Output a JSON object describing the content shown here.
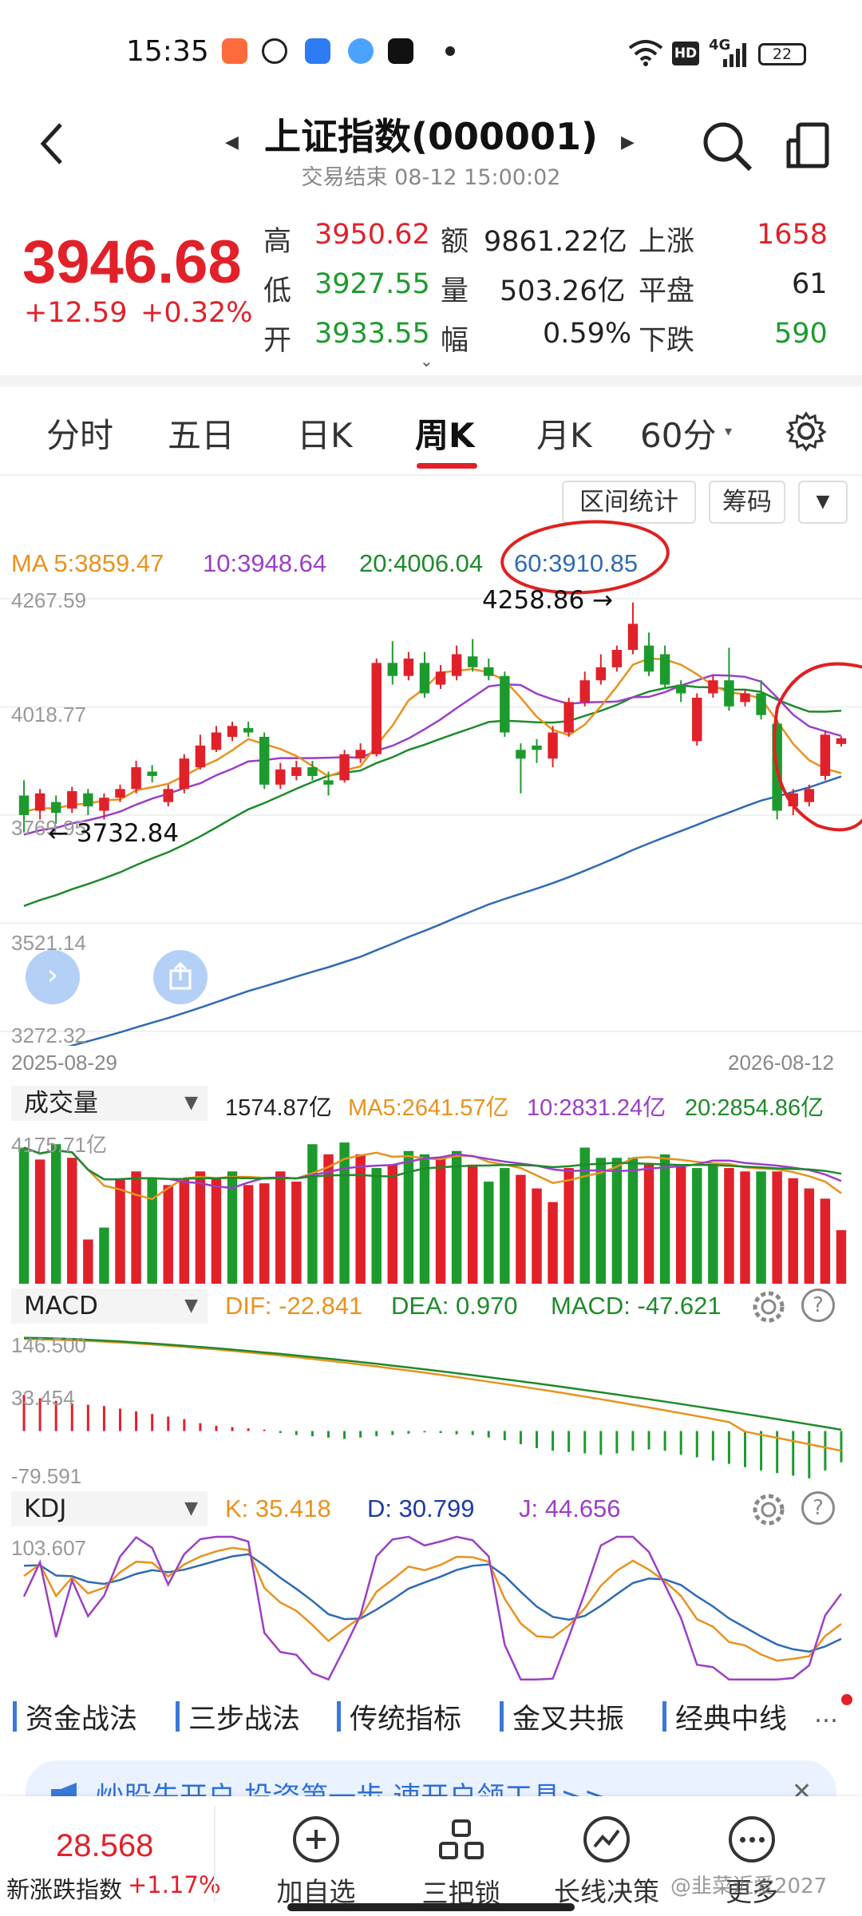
{
  "status": {
    "time": "15:35",
    "net": "4G",
    "battery": "22"
  },
  "header": {
    "title": "上证指数(000001)",
    "subtitle": "交易结束 08-12 15:00:02"
  },
  "quote": {
    "price": "3946.68",
    "change": "+12.59",
    "change_pct": "+0.32%",
    "rows": [
      {
        "l1": "高",
        "v1": "3950.62",
        "l2": "额",
        "v2": "9861.22亿",
        "l3": "上涨",
        "v3": "1658"
      },
      {
        "l1": "低",
        "v1": "3927.55",
        "l2": "量",
        "v2": "503.26亿",
        "l3": "平盘",
        "v3": "61"
      },
      {
        "l1": "开",
        "v1": "3933.55",
        "l2": "幅",
        "v2": "0.59%",
        "l3": "下跌",
        "v3": "590"
      }
    ]
  },
  "tabs": [
    "分时",
    "五日",
    "日K",
    "周K",
    "月K",
    "60分"
  ],
  "active_tab": "周K",
  "chart_tools": {
    "range_stats": "区间统计",
    "chips": "筹码"
  },
  "ma_legend": {
    "ma5": "MA 5:3859.47",
    "ma10": "10:3948.64",
    "ma20": "20:4006.04",
    "ma60": "60:3910.85"
  },
  "kline": {
    "y_ticks": [
      "4267.59",
      "4018.77",
      "3769.95",
      "3521.14",
      "3272.32"
    ],
    "high_label": "4258.86",
    "low_label": "3732.84",
    "date_start": "2025-08-29",
    "date_end": "2026-08-12"
  },
  "volume": {
    "select": "成交量",
    "latest": "1574.87亿",
    "ma5": "MA5:2641.57亿",
    "ma10": "10:2831.24亿",
    "ma20": "20:2854.86亿",
    "max": "4175.71亿"
  },
  "macd": {
    "select": "MACD",
    "dif": "DIF: -22.841",
    "dea": "DEA: 0.970",
    "macd": "MACD: -47.621",
    "top": "146.500",
    "mid": "33.454",
    "bottom": "-79.591"
  },
  "kdj": {
    "select": "KDJ",
    "k": "K: 35.418",
    "d": "D: 30.799",
    "j": "J: 44.656",
    "top": "103.607"
  },
  "strategies": [
    "资金战法",
    "三步战法",
    "传统指标",
    "金叉共振",
    "经典中线"
  ],
  "banner": {
    "text": "炒股先开户 投资第一步 速开户领工具>>"
  },
  "bottom_nav": {
    "index_value": "28.568",
    "index_name": "新涨跌指数",
    "index_change": "+1.17%",
    "items": [
      "加自选",
      "三把锁",
      "长线决策",
      "更多"
    ]
  },
  "watermark": "@韭菜近爱2027",
  "colors": {
    "up": "#e0212a",
    "down": "#1d9a2e",
    "ma5": "#e8921f",
    "ma10": "#9b3fc6",
    "ma20": "#1e8a2a",
    "ma60": "#2f6ab3"
  },
  "chart_data": {
    "type": "candlestick",
    "title": "",
    "ylim": [
      3272.32,
      4267.59
    ],
    "x_range": [
      "2025-08-29",
      "2026-08-12"
    ],
    "candles": [
      {
        "o": 3815,
        "c": 3770,
        "h": 3850,
        "l": 3730
      },
      {
        "o": 3780,
        "c": 3820,
        "h": 3830,
        "l": 3760
      },
      {
        "o": 3800,
        "c": 3775,
        "h": 3815,
        "l": 3750
      },
      {
        "o": 3785,
        "c": 3825,
        "h": 3835,
        "l": 3775
      },
      {
        "o": 3820,
        "c": 3790,
        "h": 3830,
        "l": 3770
      },
      {
        "o": 3780,
        "c": 3810,
        "h": 3820,
        "l": 3760
      },
      {
        "o": 3810,
        "c": 3830,
        "h": 3840,
        "l": 3800
      },
      {
        "o": 3830,
        "c": 3880,
        "h": 3895,
        "l": 3820
      },
      {
        "o": 3870,
        "c": 3860,
        "h": 3885,
        "l": 3845
      },
      {
        "o": 3800,
        "c": 3830,
        "h": 3840,
        "l": 3790
      },
      {
        "o": 3830,
        "c": 3900,
        "h": 3910,
        "l": 3820
      },
      {
        "o": 3880,
        "c": 3930,
        "h": 3955,
        "l": 3875
      },
      {
        "o": 3920,
        "c": 3960,
        "h": 3975,
        "l": 3915
      },
      {
        "o": 3950,
        "c": 3975,
        "h": 3985,
        "l": 3940
      },
      {
        "o": 3970,
        "c": 3960,
        "h": 3985,
        "l": 3950
      },
      {
        "o": 3950,
        "c": 3840,
        "h": 3960,
        "l": 3830
      },
      {
        "o": 3840,
        "c": 3875,
        "h": 3890,
        "l": 3830
      },
      {
        "o": 3860,
        "c": 3880,
        "h": 3895,
        "l": 3850
      },
      {
        "o": 3880,
        "c": 3860,
        "h": 3895,
        "l": 3850
      },
      {
        "o": 3850,
        "c": 3840,
        "h": 3870,
        "l": 3815
      },
      {
        "o": 3850,
        "c": 3910,
        "h": 3920,
        "l": 3845
      },
      {
        "o": 3900,
        "c": 3920,
        "h": 3935,
        "l": 3890
      },
      {
        "o": 3910,
        "c": 4120,
        "h": 4130,
        "l": 3905
      },
      {
        "o": 4120,
        "c": 4090,
        "h": 4170,
        "l": 4070
      },
      {
        "o": 4090,
        "c": 4130,
        "h": 4145,
        "l": 4080
      },
      {
        "o": 4120,
        "c": 4050,
        "h": 4145,
        "l": 4040
      },
      {
        "o": 4070,
        "c": 4100,
        "h": 4115,
        "l": 4060
      },
      {
        "o": 4090,
        "c": 4140,
        "h": 4160,
        "l": 4080
      },
      {
        "o": 4135,
        "c": 4110,
        "h": 4175,
        "l": 4100
      },
      {
        "o": 4110,
        "c": 4090,
        "h": 4130,
        "l": 4080
      },
      {
        "o": 4090,
        "c": 3960,
        "h": 4100,
        "l": 3950
      },
      {
        "o": 3920,
        "c": 3900,
        "h": 3935,
        "l": 3820
      },
      {
        "o": 3930,
        "c": 3920,
        "h": 3945,
        "l": 3890
      },
      {
        "o": 3900,
        "c": 3960,
        "h": 3975,
        "l": 3880
      },
      {
        "o": 3960,
        "c": 4030,
        "h": 4040,
        "l": 3950
      },
      {
        "o": 4030,
        "c": 4080,
        "h": 4100,
        "l": 4020
      },
      {
        "o": 4080,
        "c": 4110,
        "h": 4140,
        "l": 4070
      },
      {
        "o": 4110,
        "c": 4150,
        "h": 4160,
        "l": 4100
      },
      {
        "o": 4150,
        "c": 4210,
        "h": 4258.86,
        "l": 4140
      },
      {
        "o": 4160,
        "c": 4100,
        "h": 4190,
        "l": 4090
      },
      {
        "o": 4140,
        "c": 4070,
        "h": 4160,
        "l": 4060
      },
      {
        "o": 4070,
        "c": 4050,
        "h": 4080,
        "l": 4030
      },
      {
        "o": 3940,
        "c": 4040,
        "h": 4050,
        "l": 3930
      },
      {
        "o": 4050,
        "c": 4080,
        "h": 4090,
        "l": 4040
      },
      {
        "o": 4080,
        "c": 4020,
        "h": 4155,
        "l": 4010
      },
      {
        "o": 4030,
        "c": 4050,
        "h": 4060,
        "l": 4020
      },
      {
        "o": 4050,
        "c": 4000,
        "h": 4080,
        "l": 3990
      },
      {
        "o": 3980,
        "c": 3780,
        "h": 3990,
        "l": 3760
      },
      {
        "o": 3790,
        "c": 3820,
        "h": 3830,
        "l": 3770
      },
      {
        "o": 3800,
        "c": 3830,
        "h": 3840,
        "l": 3790
      },
      {
        "o": 3860,
        "c": 3955,
        "h": 3965,
        "l": 3850
      },
      {
        "o": 3933.55,
        "c": 3946.68,
        "h": 3950.62,
        "l": 3927.55
      }
    ],
    "volume": {
      "ylim": [
        0,
        4175.71
      ],
      "values": [
        {
          "v": 4000,
          "up": false
        },
        {
          "v": 3650,
          "up": true
        },
        {
          "v": 4100,
          "up": false
        },
        {
          "v": 3700,
          "up": true
        },
        {
          "v": 1300,
          "up": true
        },
        {
          "v": 1650,
          "up": false
        },
        {
          "v": 3100,
          "up": true
        },
        {
          "v": 3300,
          "up": true
        },
        {
          "v": 3100,
          "up": false
        },
        {
          "v": 2900,
          "up": true
        },
        {
          "v": 3100,
          "up": true
        },
        {
          "v": 3300,
          "up": true
        },
        {
          "v": 3100,
          "up": true
        },
        {
          "v": 3300,
          "up": false
        },
        {
          "v": 2900,
          "up": true
        },
        {
          "v": 2950,
          "up": true
        },
        {
          "v": 3300,
          "up": true
        },
        {
          "v": 3000,
          "up": true
        },
        {
          "v": 4100,
          "up": false
        },
        {
          "v": 3800,
          "up": true
        },
        {
          "v": 4150,
          "up": false
        },
        {
          "v": 3800,
          "up": true
        },
        {
          "v": 3400,
          "up": false
        },
        {
          "v": 3500,
          "up": true
        },
        {
          "v": 3900,
          "up": false
        },
        {
          "v": 3800,
          "up": false
        },
        {
          "v": 3700,
          "up": true
        },
        {
          "v": 3900,
          "up": false
        },
        {
          "v": 3500,
          "up": true
        },
        {
          "v": 3000,
          "up": false
        },
        {
          "v": 3400,
          "up": false
        },
        {
          "v": 3200,
          "up": true
        },
        {
          "v": 2800,
          "up": true
        },
        {
          "v": 2400,
          "up": true
        },
        {
          "v": 3400,
          "up": true
        },
        {
          "v": 4000,
          "up": false
        },
        {
          "v": 3700,
          "up": false
        },
        {
          "v": 3700,
          "up": false
        },
        {
          "v": 3700,
          "up": false
        },
        {
          "v": 3500,
          "up": true
        },
        {
          "v": 3800,
          "up": false
        },
        {
          "v": 3500,
          "up": true
        },
        {
          "v": 3400,
          "up": false
        },
        {
          "v": 3500,
          "up": false
        },
        {
          "v": 3400,
          "up": true
        },
        {
          "v": 3300,
          "up": true
        },
        {
          "v": 3300,
          "up": false
        },
        {
          "v": 3300,
          "up": true
        },
        {
          "v": 3100,
          "up": true
        },
        {
          "v": 2800,
          "up": true
        },
        {
          "v": 2500,
          "up": true
        },
        {
          "v": 1574.87,
          "up": true
        }
      ]
    },
    "macd": {
      "ylim": [
        -79.591,
        146.5
      ],
      "hist": [
        55,
        50,
        46,
        42,
        40,
        38,
        34,
        30,
        26,
        22,
        18,
        12,
        8,
        6,
        4,
        2,
        -3,
        -6,
        -8,
        -10,
        -12,
        -10,
        -8,
        -6,
        -4,
        -2,
        -3,
        -5,
        -6,
        -10,
        -14,
        -20,
        -26,
        -30,
        -32,
        -34,
        -36,
        -34,
        -30,
        -28,
        -30,
        -36,
        -40,
        -45,
        -50,
        -55,
        -60,
        -64,
        -68,
        -72,
        -60,
        -47.621
      ]
    },
    "kdj": {
      "ylim": [
        -10,
        103.607
      ]
    }
  }
}
